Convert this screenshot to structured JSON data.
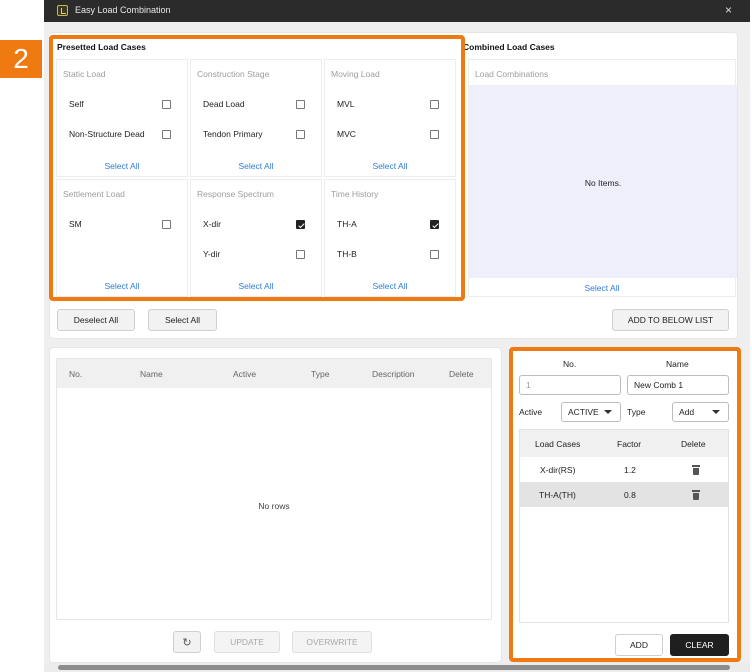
{
  "window": {
    "title": "Easy Load Combination",
    "close": "×"
  },
  "badge": "2",
  "presetted": {
    "title": "Presetted Load Cases",
    "select_all": "Select All",
    "groups": [
      {
        "title": "Static Load",
        "items": [
          {
            "label": "Self",
            "checked": false
          },
          {
            "label": "Non-Structure Dead",
            "checked": false
          }
        ]
      },
      {
        "title": "Construction Stage",
        "items": [
          {
            "label": "Dead Load",
            "checked": false
          },
          {
            "label": "Tendon Primary",
            "checked": false
          }
        ]
      },
      {
        "title": "Moving Load",
        "items": [
          {
            "label": "MVL",
            "checked": false
          },
          {
            "label": "MVC",
            "checked": false
          }
        ]
      },
      {
        "title": "Settlement Load",
        "items": [
          {
            "label": "SM",
            "checked": false
          }
        ]
      },
      {
        "title": "Response Spectrum",
        "items": [
          {
            "label": "X-dir",
            "checked": true
          },
          {
            "label": "Y-dir",
            "checked": false
          }
        ]
      },
      {
        "title": "Time History",
        "items": [
          {
            "label": "TH-A",
            "checked": true
          },
          {
            "label": "TH-B",
            "checked": false
          }
        ]
      }
    ]
  },
  "combined": {
    "title": "Combined Load Cases",
    "subtitle": "Load Combinations",
    "empty": "No Items.",
    "select_all": "Select All"
  },
  "actions": {
    "deselect_all": "Deselect All",
    "select_all": "Select All",
    "add_to_list": "ADD TO BELOW LIST"
  },
  "table": {
    "columns": [
      "No.",
      "Name",
      "Active",
      "Type",
      "Description",
      "Delete"
    ],
    "empty": "No rows",
    "refresh_icon": "↻",
    "update": "UPDATE",
    "overwrite": "OVERWRITE"
  },
  "editor": {
    "no_label": "No.",
    "name_label": "Name",
    "no_placeholder": "1",
    "name_value": "New Comb 1",
    "active_label": "Active",
    "active_value": "ACTIVE",
    "type_label": "Type",
    "type_value": "Add",
    "columns": [
      "Load Cases",
      "Factor",
      "Delete"
    ],
    "rows": [
      {
        "load_case": "X-dir(RS)",
        "factor": "1.2"
      },
      {
        "load_case": "TH-A(TH)",
        "factor": "0.8"
      }
    ],
    "add": "ADD",
    "clear": "CLEAR"
  },
  "colors": {
    "highlight": "#f07a12",
    "link": "#2f7bd8",
    "titlebar": "#2b2b2b"
  }
}
